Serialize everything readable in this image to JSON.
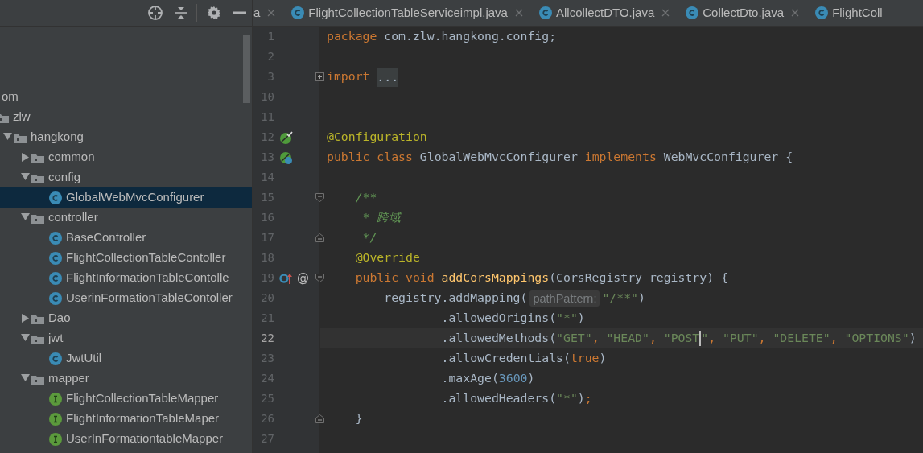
{
  "tree": [
    {
      "label": "om",
      "selected": false,
      "children": [
        {
          "label": "zlw",
          "kind": "folder",
          "selected": false,
          "children": [
            {
              "label": "hangkong",
              "kind": "folder",
              "expanded": true,
              "selected": false,
              "children": [
                {
                  "label": "common",
                  "kind": "folder",
                  "expanded": false,
                  "selected": false
                },
                {
                  "label": "config",
                  "kind": "folder",
                  "expanded": true,
                  "selected": false,
                  "children": [
                    {
                      "label": "GlobalWebMvcConfigurer",
                      "kind": "class",
                      "selected": true
                    }
                  ]
                },
                {
                  "label": "controller",
                  "kind": "folder",
                  "expanded": true,
                  "selected": false,
                  "children": [
                    {
                      "label": "BaseController",
                      "kind": "class",
                      "selected": false
                    },
                    {
                      "label": "FlightCollectionTableContoller",
                      "kind": "class",
                      "selected": false
                    },
                    {
                      "label": "FlightInformationTableContolle",
                      "kind": "class",
                      "selected": false
                    },
                    {
                      "label": "UserinFormationTableContoller",
                      "kind": "class",
                      "selected": false
                    }
                  ]
                },
                {
                  "label": "Dao",
                  "kind": "folder",
                  "expanded": false,
                  "selected": false
                },
                {
                  "label": "jwt",
                  "kind": "folder",
                  "expanded": true,
                  "selected": false,
                  "children": [
                    {
                      "label": "JwtUtil",
                      "kind": "class",
                      "selected": false
                    }
                  ]
                },
                {
                  "label": "mapper",
                  "kind": "folder",
                  "expanded": true,
                  "selected": false,
                  "children": [
                    {
                      "label": "FlightCollectionTableMapper",
                      "kind": "interface",
                      "selected": false
                    },
                    {
                      "label": "FlightInformationTableMaper",
                      "kind": "interface",
                      "selected": false
                    },
                    {
                      "label": "UserInFormationtableMapper",
                      "kind": "interface",
                      "selected": false
                    }
                  ]
                }
              ]
            }
          ]
        }
      ]
    }
  ],
  "tabs": [
    {
      "label": "a",
      "selected": false,
      "closable": true
    },
    {
      "label": "FlightCollectionTableServiceimpl.java",
      "kind": "class",
      "selected": false,
      "closable": true
    },
    {
      "label": "AllcollectDTO.java",
      "kind": "class",
      "selected": false,
      "closable": true
    },
    {
      "label": "CollectDto.java",
      "kind": "class",
      "selected": false,
      "closable": true
    },
    {
      "label": "FlightColl",
      "kind": "class",
      "selected": false,
      "closable": false
    }
  ],
  "editor": {
    "lines": [
      {
        "number": "1",
        "current": false,
        "tokens": [
          {
            "kind": "keyword",
            "text": "package"
          },
          {
            "kind": "plain",
            "text": " com.zlw.hangkong.config;"
          }
        ]
      },
      {
        "number": "2",
        "current": false
      },
      {
        "number": "3",
        "current": false,
        "fold": {
          "kind": "expand"
        },
        "tokens": [
          {
            "kind": "keyword",
            "text": "import"
          },
          {
            "kind": "folded",
            "text": "..."
          }
        ]
      },
      {
        "number": "10",
        "current": false
      },
      {
        "number": "11",
        "current": false
      },
      {
        "number": "12",
        "current": false,
        "gutter": [
          {
            "kind": "bean-check"
          }
        ],
        "tokens": [
          {
            "kind": "annotation",
            "text": "@Configuration"
          }
        ]
      },
      {
        "number": "13",
        "current": false,
        "gutter": [
          {
            "kind": "bean-class"
          }
        ],
        "tokens": [
          {
            "kind": "keyword",
            "text": "public class"
          },
          {
            "kind": "plain",
            "text": " GlobalWebMvcConfigurer "
          },
          {
            "kind": "keyword",
            "text": "implements"
          },
          {
            "kind": "plain",
            "text": " WebMvcConfigurer {"
          }
        ]
      },
      {
        "number": "14",
        "current": false
      },
      {
        "number": "15",
        "current": false,
        "fold": {
          "kind": "open"
        },
        "tokens": [
          {
            "kind": "doc",
            "text": "    /**"
          }
        ]
      },
      {
        "number": "16",
        "current": false,
        "tokens": [
          {
            "kind": "doc",
            "text": "     * 跨域"
          }
        ]
      },
      {
        "number": "17",
        "current": false,
        "fold": {
          "kind": "close"
        },
        "tokens": [
          {
            "kind": "doc",
            "text": "     */"
          }
        ]
      },
      {
        "number": "18",
        "current": false,
        "tokens": [
          {
            "kind": "annotation",
            "text": "    @Override"
          }
        ]
      },
      {
        "number": "19",
        "current": false,
        "fold": {
          "kind": "open"
        },
        "gutter": [
          {
            "kind": "override"
          },
          {
            "kind": "glyph",
            "text": "@"
          }
        ],
        "tokens": [
          {
            "kind": "keyword",
            "text": "    public void "
          },
          {
            "kind": "method",
            "text": "addCorsMappings"
          },
          {
            "kind": "plain",
            "text": "(CorsRegistry registry) {"
          }
        ]
      },
      {
        "number": "20",
        "current": false,
        "tokens": [
          {
            "kind": "plain",
            "text": "        registry.addMapping("
          },
          {
            "kind": "hint",
            "text": "pathPattern:"
          },
          {
            "kind": "string",
            "text": "\"/**\""
          },
          {
            "kind": "plain",
            "text": ")"
          }
        ]
      },
      {
        "number": "21",
        "current": false,
        "tokens": [
          {
            "kind": "plain",
            "text": "                .allowedOrigins("
          },
          {
            "kind": "string",
            "text": "\"*\""
          },
          {
            "kind": "plain",
            "text": ")"
          }
        ]
      },
      {
        "number": "22",
        "current": true,
        "tokens": [
          {
            "kind": "plain",
            "text": "                .allowedMethods("
          },
          {
            "kind": "string",
            "text": "\"GET\""
          },
          {
            "kind": "keyword",
            "text": ", "
          },
          {
            "kind": "string",
            "text": "\"HEAD\""
          },
          {
            "kind": "keyword",
            "text": ", "
          },
          {
            "kind": "string",
            "text": "\"POST"
          },
          {
            "kind": "caret"
          },
          {
            "kind": "string",
            "text": "\""
          },
          {
            "kind": "keyword",
            "text": ", "
          },
          {
            "kind": "string",
            "text": "\"PUT\""
          },
          {
            "kind": "keyword",
            "text": ", "
          },
          {
            "kind": "string",
            "text": "\"DELETE\""
          },
          {
            "kind": "keyword",
            "text": ", "
          },
          {
            "kind": "string",
            "text": "\"OPTIONS\""
          },
          {
            "kind": "plain",
            "text": ")"
          }
        ]
      },
      {
        "number": "23",
        "current": false,
        "tokens": [
          {
            "kind": "plain",
            "text": "                .allowCredentials("
          },
          {
            "kind": "keyword",
            "text": "true"
          },
          {
            "kind": "plain",
            "text": ")"
          }
        ]
      },
      {
        "number": "24",
        "current": false,
        "tokens": [
          {
            "kind": "plain",
            "text": "                .maxAge("
          },
          {
            "kind": "number",
            "text": "3600"
          },
          {
            "kind": "plain",
            "text": ")"
          }
        ]
      },
      {
        "number": "25",
        "current": false,
        "tokens": [
          {
            "kind": "plain",
            "text": "                .allowedHeaders("
          },
          {
            "kind": "string",
            "text": "\"*\""
          },
          {
            "kind": "plain",
            "text": ")"
          },
          {
            "kind": "keyword",
            "text": ";"
          }
        ]
      },
      {
        "number": "26",
        "current": false,
        "fold": {
          "kind": "close"
        },
        "tokens": [
          {
            "kind": "plain",
            "text": "    }"
          }
        ]
      },
      {
        "number": "27",
        "current": false
      }
    ]
  }
}
